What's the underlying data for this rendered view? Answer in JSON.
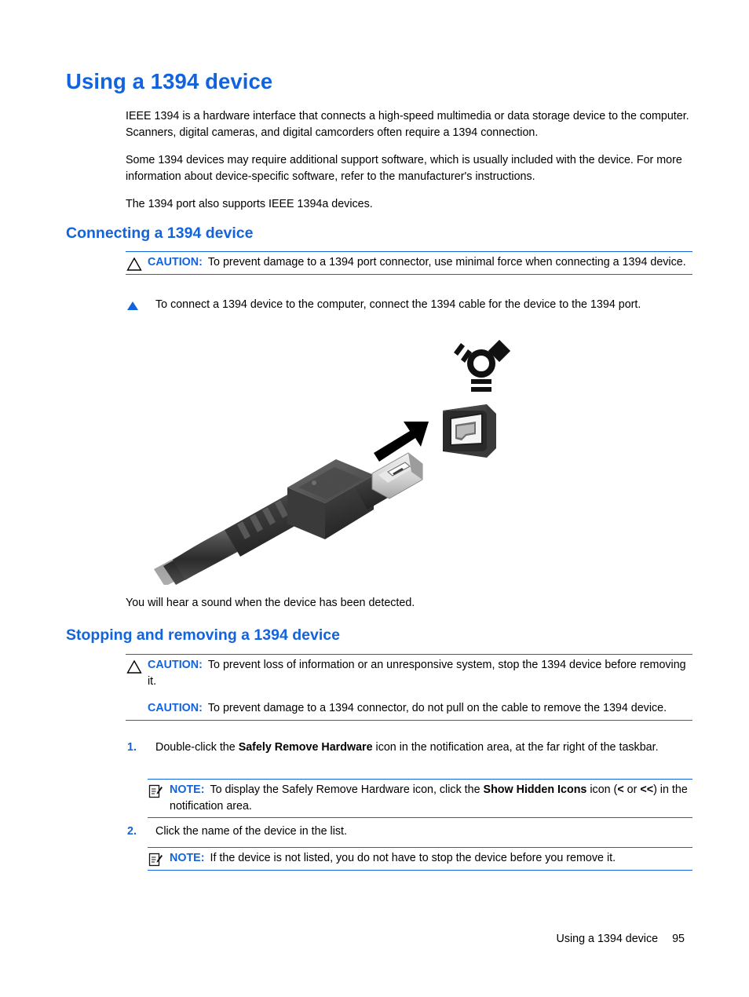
{
  "page": {
    "title": "Using a 1394 device",
    "number": "95",
    "accent_blue": "#1263DE",
    "text_black": "#000000"
  },
  "intro": {
    "paragraphs": [
      "IEEE 1394 is a hardware interface that connects a high-speed multimedia or data storage device to the computer. Scanners, digital cameras, and digital camcorders often require a 1394 connection.",
      "Some 1394 devices may require additional support software, which is usually included with the device. For more information about device-specific software, refer to the manufacturer's instructions.",
      "The 1394 port also supports IEEE 1394a devices."
    ]
  },
  "section_connecting": {
    "heading": "Connecting a 1394 device",
    "caution": {
      "label": "CAUTION:",
      "icon": "caution-triangle-icon",
      "text": "To prevent damage to a 1394 port connector, use minimal force when connecting a 1394 device."
    },
    "step": {
      "marker": "triangle-bullet-icon",
      "text": "To connect a 1394 device to the computer, connect the 1394 cable for the device to the 1394 port."
    },
    "figure": {
      "alt": "1394 cable connector being inserted into a 1394 port",
      "parts": [
        "firewire-logo-icon",
        "port-receptacle-icon",
        "insertion-arrow-icon",
        "firewire-cable-connector"
      ]
    },
    "after_figure": "You will hear a sound when the device has been detected."
  },
  "section_stopping": {
    "heading": "Stopping and removing a 1394 device",
    "cautions": [
      {
        "label": "CAUTION:",
        "icon": "caution-triangle-icon",
        "text": "To prevent loss of information or an unresponsive system, stop the 1394 device before removing it."
      },
      {
        "label": "CAUTION:",
        "text": "To prevent damage to a 1394 connector, do not pull on the cable to remove the 1394 device."
      }
    ],
    "steps": [
      {
        "marker": "1.",
        "text_before": "Double-click the ",
        "bold": "Safely Remove Hardware",
        "text_after": " icon in the notification area, at the far right of the taskbar."
      },
      {
        "marker": "2.",
        "text_before": "Click the name of the device in the list.",
        "bold": "",
        "text_after": ""
      }
    ],
    "notes": [
      {
        "label": "NOTE:",
        "icon": "note-icon",
        "text_before": "To display the Safely Remove Hardware icon, click the ",
        "bold1": "Show Hidden Icons",
        "text_mid": " icon (",
        "bold2": "<",
        "text_mid2": " or ",
        "bold3": "<<",
        "text_after": ") in the notification area."
      },
      {
        "label": "NOTE:",
        "icon": "note-icon",
        "text": "If the device is not listed, you do not have to stop the device before you remove it."
      }
    ]
  },
  "footer": {
    "title": "Using a 1394 device",
    "page_number": "95"
  }
}
